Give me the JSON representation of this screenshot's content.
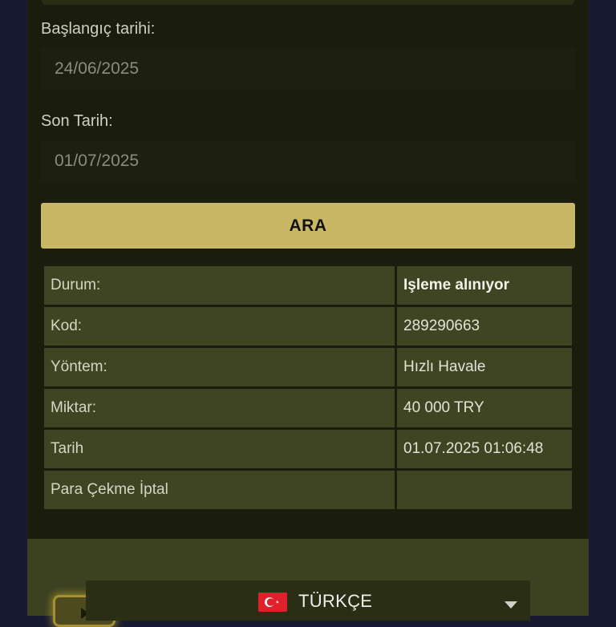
{
  "filters": {
    "start_label": "Başlangıç tarihi:",
    "start_value": "24/06/2025",
    "end_label": "Son Tarih:",
    "end_value": "01/07/2025",
    "search_button": "ARA"
  },
  "details": {
    "rows": [
      {
        "key": "Durum:",
        "value": "Işleme alınıyor"
      },
      {
        "key": "Kod:",
        "value": "289290663"
      },
      {
        "key": "Yöntem:",
        "value": "Hızlı Havale"
      },
      {
        "key": "Miktar:",
        "value": "40 000 TRY"
      },
      {
        "key": "Tarih",
        "value": "01.07.2025 01:06:48"
      },
      {
        "key": "Para Çekme İptal",
        "value": ""
      }
    ]
  },
  "footer": {
    "language": "TÜRKÇE",
    "flag_icon": "turkey-flag-icon"
  },
  "colors": {
    "accent": "#c9b765",
    "panel": "#1a1c0d",
    "table_cell": "#3f4522"
  }
}
